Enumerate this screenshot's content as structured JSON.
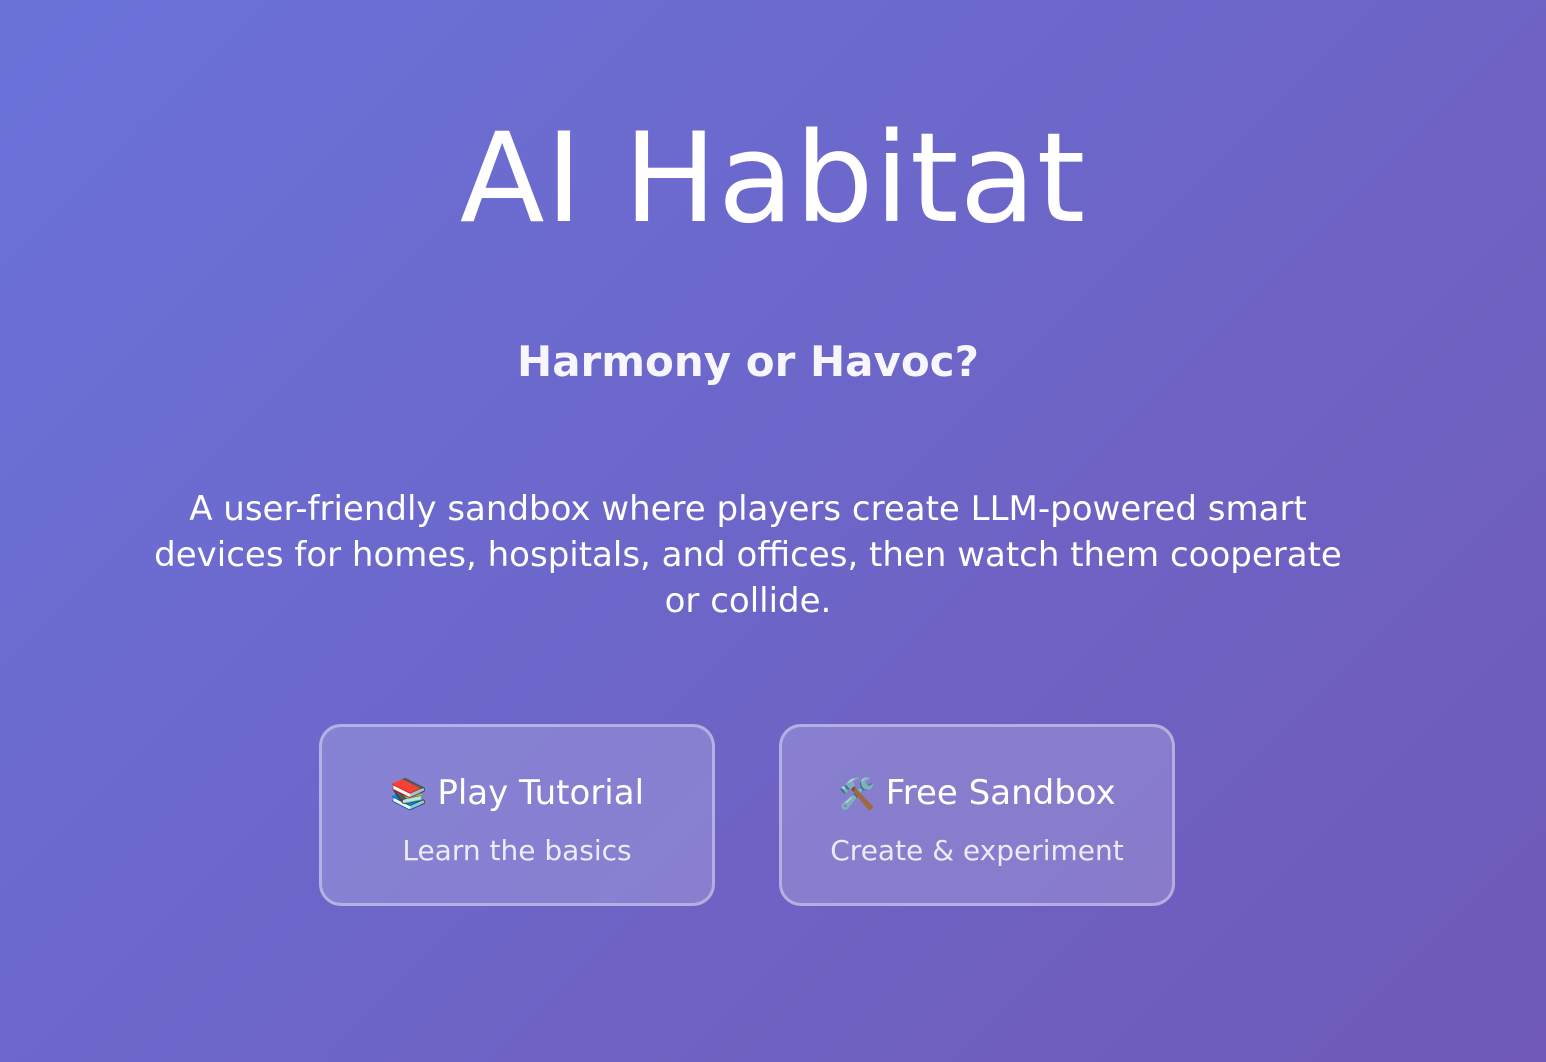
{
  "page": {
    "title": "AI Habitat",
    "subtitle": "Harmony or Havoc?",
    "description": "A user-friendly sandbox where players create LLM-powered smart devices for homes, hospitals, and offices, then watch them cooperate or collide."
  },
  "actions": [
    {
      "icon_name": "books-icon",
      "icon_glyph": "📚",
      "label": "Play Tutorial",
      "description": "Learn the basics"
    },
    {
      "icon_name": "tools-icon",
      "icon_glyph": "🛠️",
      "label": "Free Sandbox",
      "description": "Create & experiment"
    }
  ],
  "colors": {
    "background_start": "#6a72d9",
    "background_end": "#7059b8",
    "text": "#ffffff"
  }
}
